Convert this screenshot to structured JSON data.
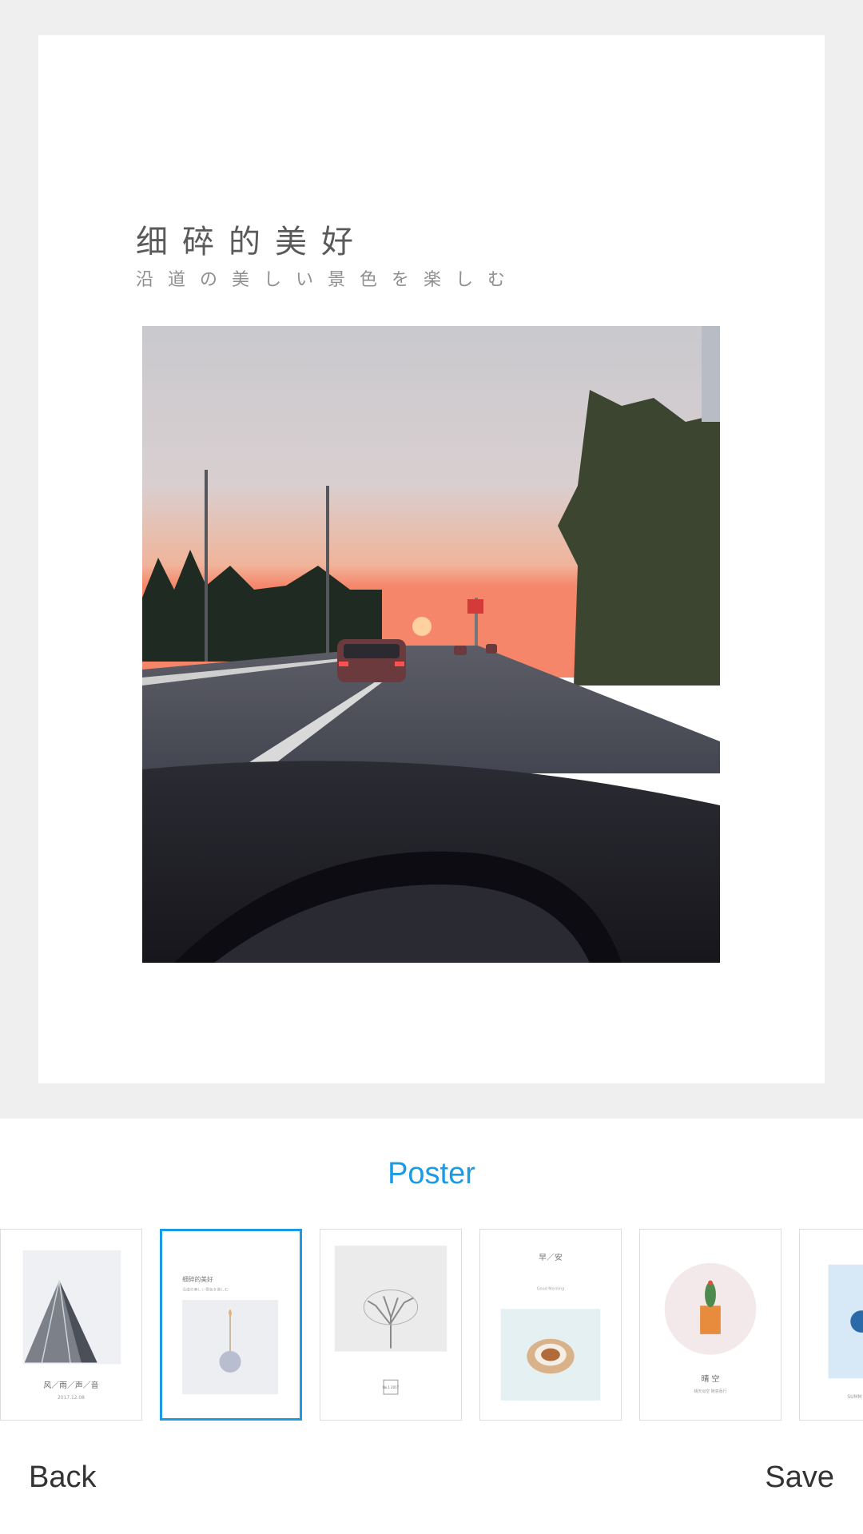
{
  "poster": {
    "title": "细碎的美好",
    "subtitle": "沿道の美しい景色を楽しむ"
  },
  "template_section": {
    "label": "Poster"
  },
  "templates": [
    {
      "thumb_text": "风／雨／声／音",
      "thumb_subtext": "2017.12.08",
      "selected": false
    },
    {
      "thumb_text": "细碎的美好",
      "thumb_subtext": "沿道の美しい景色を楽しむ",
      "selected": true
    },
    {
      "thumb_text": "No.1 2017",
      "selected": false
    },
    {
      "thumb_text": "早／安",
      "thumb_subtext": "Good Morning",
      "selected": false
    },
    {
      "thumb_text": "晴 空",
      "thumb_subtext": "晴天似空 随意而行",
      "selected": false
    },
    {
      "thumb_text": "SUMM",
      "selected": false
    }
  ],
  "footer": {
    "back_label": "Back",
    "save_label": "Save"
  },
  "colors": {
    "accent": "#1a9be6",
    "preview_bg": "#efefef"
  }
}
